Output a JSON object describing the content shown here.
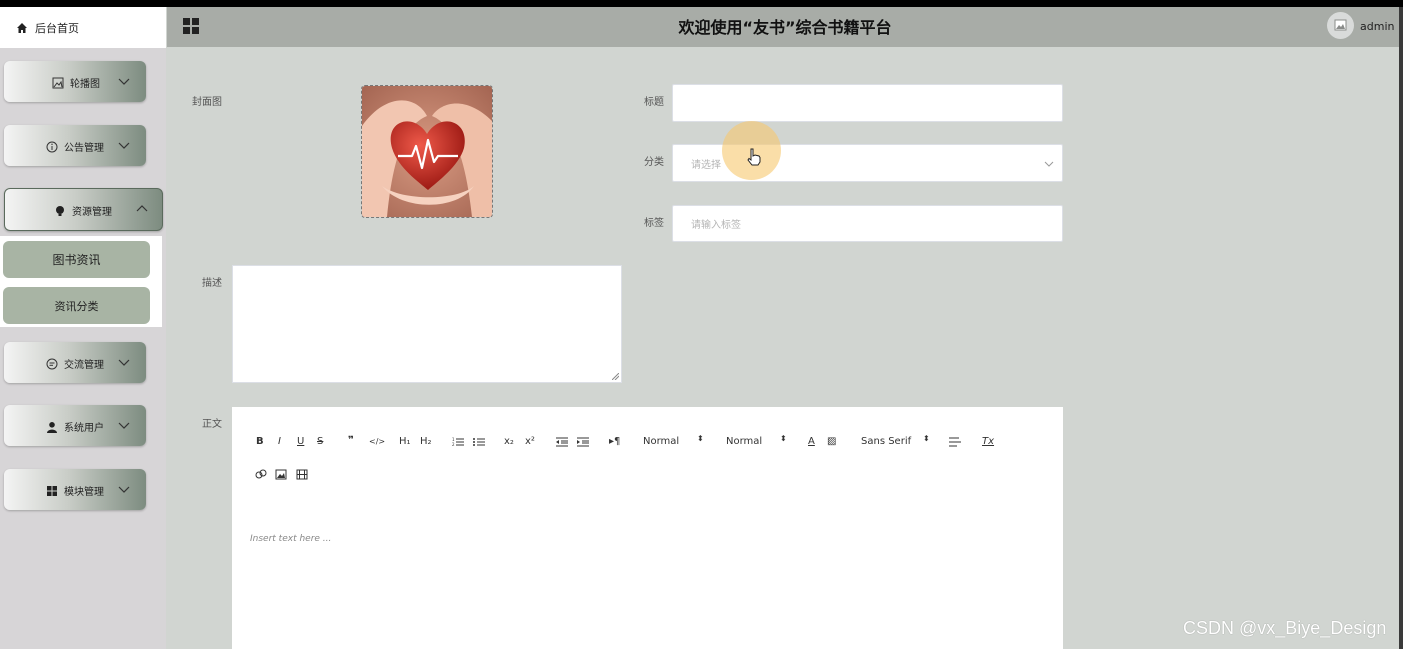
{
  "header": {
    "title": "欢迎使用“友书”综合书籍平台",
    "user": "admin"
  },
  "nav": {
    "home": "后台首页"
  },
  "sidebar": {
    "items": [
      {
        "label": "轮播图",
        "icon": "image-icon"
      },
      {
        "label": "公告管理",
        "icon": "info-icon"
      },
      {
        "label": "资源管理",
        "icon": "bulb-icon",
        "expanded": true
      },
      {
        "label": "交流管理",
        "icon": "chat-icon"
      },
      {
        "label": "系统用户",
        "icon": "user-icon"
      },
      {
        "label": "模块管理",
        "icon": "grid-icon"
      }
    ],
    "sub": [
      "图书资讯",
      "资讯分类"
    ]
  },
  "form": {
    "cover_label": "封面图",
    "title_label": "标题",
    "title_value": "",
    "category_label": "分类",
    "category_placeholder": "请选择",
    "tags_label": "标签",
    "tags_placeholder": "请输入标签",
    "desc_label": "描述",
    "body_label": "正文",
    "editor_placeholder": "Insert text here ..."
  },
  "toolbar": {
    "header_select": "Normal",
    "size_select": "Normal",
    "font_select": "Sans Serif"
  },
  "watermark": "CSDN @vx_Biye_Design"
}
